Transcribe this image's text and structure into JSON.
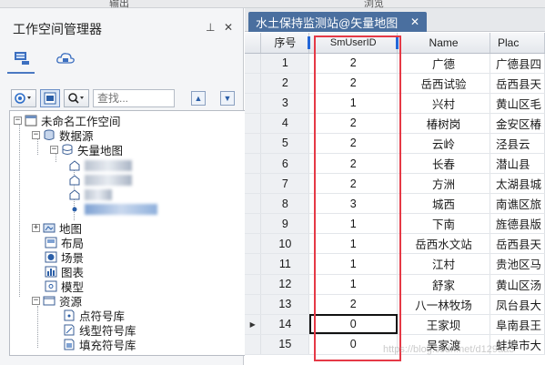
{
  "topstrip": {
    "left_label": "输出",
    "right_label": "浏览"
  },
  "workspace_panel": {
    "title": "工作空间管理器",
    "pin_glyph": "⊥",
    "close_glyph": "✕",
    "search_placeholder": "查找...",
    "tree": {
      "root": "未命名工作空间",
      "datasources": "数据源",
      "datasource_name": "矢量地图",
      "maps": "地图",
      "layouts": "布局",
      "scenes": "场景",
      "charts": "图表",
      "models": "模型",
      "resources": "资源",
      "symbol_point": "点符号库",
      "symbol_line": "线型符号库",
      "symbol_fill": "填充符号库"
    }
  },
  "tab": {
    "label": "水土保持监测站@矢量地图",
    "close_glyph": "✕"
  },
  "grid": {
    "headers": [
      "序号",
      "SmUserID",
      "Name",
      "Plac"
    ],
    "rows": [
      {
        "seq": "1",
        "smuserid": "2",
        "name": "广德",
        "place": "广德县四"
      },
      {
        "seq": "2",
        "smuserid": "2",
        "name": "岳西试验",
        "place": "岳西县天"
      },
      {
        "seq": "3",
        "smuserid": "1",
        "name": "兴村",
        "place": "黄山区毛"
      },
      {
        "seq": "4",
        "smuserid": "2",
        "name": "椿树岗",
        "place": "金安区椿"
      },
      {
        "seq": "5",
        "smuserid": "2",
        "name": "云岭",
        "place": "泾县云"
      },
      {
        "seq": "6",
        "smuserid": "2",
        "name": "长春",
        "place": "潜山县"
      },
      {
        "seq": "7",
        "smuserid": "2",
        "name": "方洲",
        "place": "太湖县城"
      },
      {
        "seq": "8",
        "smuserid": "3",
        "name": "城西",
        "place": "南谯区旅"
      },
      {
        "seq": "9",
        "smuserid": "1",
        "name": "下南",
        "place": "旌德县版"
      },
      {
        "seq": "10",
        "smuserid": "1",
        "name": "岳西水文站",
        "place": "岳西县天"
      },
      {
        "seq": "11",
        "smuserid": "1",
        "name": "江村",
        "place": "贵池区马"
      },
      {
        "seq": "12",
        "smuserid": "1",
        "name": "舒家",
        "place": "黄山区汤"
      },
      {
        "seq": "13",
        "smuserid": "2",
        "name": "八一林牧场",
        "place": "凤台县大"
      },
      {
        "seq": "14",
        "smuserid": "0",
        "name": "王家坝",
        "place": "阜南县王"
      },
      {
        "seq": "15",
        "smuserid": "0",
        "name": "吴家渡",
        "place": "蚌埠市大"
      }
    ],
    "current_row_marker": "▶"
  },
  "watermark": "https://blog.csdn.net/d129aa3"
}
